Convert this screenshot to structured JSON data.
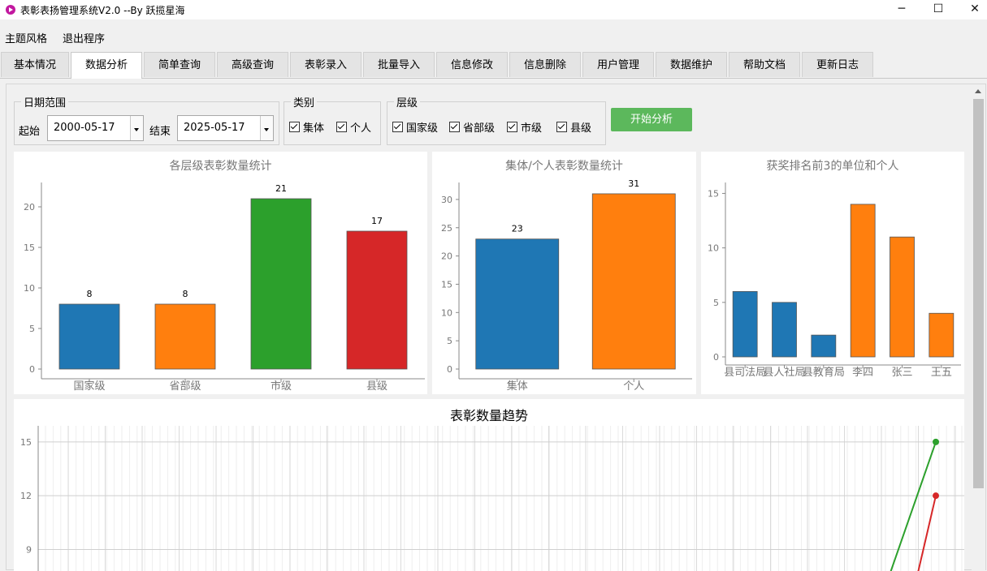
{
  "window": {
    "title": "表彰表扬管理系统V2.0 --By 跃揽星海",
    "minimize": "─",
    "maximize": "☐",
    "close": "✕"
  },
  "menu": [
    "主题风格",
    "退出程序"
  ],
  "tabs": [
    "基本情况",
    "数据分析",
    "简单查询",
    "高级查询",
    "表彰录入",
    "批量导入",
    "信息修改",
    "信息删除",
    "用户管理",
    "数据维护",
    "帮助文档",
    "更新日志"
  ],
  "active_tab": "数据分析",
  "filters": {
    "date_group_title": "日期范围",
    "start_label": "起始",
    "start_value": "2000-05-17",
    "end_label": "结束",
    "end_value": "2025-05-17",
    "category_group_title": "类别",
    "category_options": [
      "集体",
      "个人"
    ],
    "level_group_title": "层级",
    "level_options": [
      "国家级",
      "省部级",
      "市级",
      "县级"
    ],
    "start_button": "开始分析"
  },
  "colors": {
    "blue": "#1f77b4",
    "orange": "#ff7f0e",
    "green": "#2ca02c",
    "red": "#d62728",
    "button_green": "#5cb85c"
  },
  "chart_data": [
    {
      "type": "bar",
      "title": "各层级表彰数量统计",
      "categories": [
        "国家级",
        "省部级",
        "市级",
        "县级"
      ],
      "values": [
        8,
        8,
        21,
        17
      ],
      "colors": [
        "#1f77b4",
        "#ff7f0e",
        "#2ca02c",
        "#d62728"
      ],
      "ylim": [
        0,
        23
      ],
      "yticks": [
        0,
        5,
        10,
        15,
        20
      ],
      "data_labels": true
    },
    {
      "type": "bar",
      "title": "集体/个人表彰数量统计",
      "categories": [
        "集体",
        "个人"
      ],
      "values": [
        23,
        31
      ],
      "colors": [
        "#1f77b4",
        "#ff7f0e"
      ],
      "ylim": [
        0,
        33
      ],
      "yticks": [
        0,
        5,
        10,
        15,
        20,
        25,
        30
      ],
      "data_labels": true
    },
    {
      "type": "bar",
      "title": "获奖排名前3的单位和个人",
      "categories": [
        "县司法局",
        "县人社局",
        "县教育局",
        "李四",
        "张三",
        "王五"
      ],
      "values": [
        6,
        5,
        2,
        14,
        11,
        4
      ],
      "colors": [
        "#1f77b4",
        "#1f77b4",
        "#1f77b4",
        "#ff7f0e",
        "#ff7f0e",
        "#ff7f0e"
      ],
      "ylim": [
        0,
        16
      ],
      "yticks": [
        0,
        5,
        10,
        15
      ],
      "data_labels": false
    },
    {
      "type": "line",
      "title": "表彰数量趋势",
      "yticks": [
        9,
        12,
        15
      ],
      "ylim_visible": [
        7.8,
        15.9
      ],
      "series": [
        {
          "color": "#2ca02c",
          "last_value": 15
        },
        {
          "color": "#d62728",
          "last_value": 12
        }
      ]
    }
  ]
}
